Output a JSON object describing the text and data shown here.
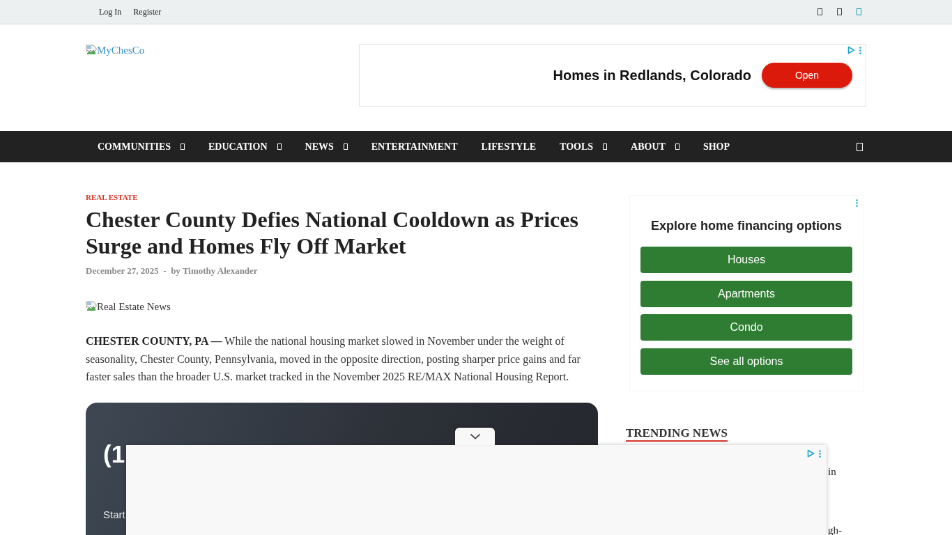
{
  "top_bar": {
    "links": [
      "Log In",
      "Register"
    ],
    "social_icons": [
      {
        "color": "#444444"
      },
      {
        "color": "#444444"
      },
      {
        "color": "#1e9bb3"
      }
    ]
  },
  "header": {
    "logo_alt": "MyChesCo",
    "ad": {
      "headline": "Homes in Redlands, Colorado",
      "button": "Open"
    }
  },
  "nav": {
    "items": [
      {
        "label": "COMMUNITIES",
        "has_submenu": true
      },
      {
        "label": "EDUCATION",
        "has_submenu": true
      },
      {
        "label": "NEWS",
        "has_submenu": true
      },
      {
        "label": "ENTERTAINMENT",
        "has_submenu": false
      },
      {
        "label": "LIFESTYLE",
        "has_submenu": false
      },
      {
        "label": "TOOLS",
        "has_submenu": true
      },
      {
        "label": "ABOUT",
        "has_submenu": true
      },
      {
        "label": "SHOP",
        "has_submenu": false
      }
    ]
  },
  "article": {
    "category": "REAL ESTATE",
    "title": "Chester County Defies National Cooldown as Prices Surge and Homes Fly Off Market",
    "meta": "December 27, 2025  -  by Timothy Alexander",
    "image_alt": "Real Estate News",
    "lead": "**CHESTER COUNTY, PA —** While the national housing market slowed in November under the weight of seasonality, Chester County, Pennsylvania, moved in the opposite direction, posting sharper price gains and far faster sales than the broader U.S. market tracked in the November 2025 RE/MAX National Housing Report.",
    "card": {
      "heading": "(1",
      "text": "Start"
    }
  },
  "sidebar": {
    "ad": {
      "title": "Explore home financing options",
      "buttons": [
        "Houses",
        "Apartments",
        "Condo",
        "See all options"
      ]
    },
    "trending": {
      "title": "TRENDING NEWS",
      "items": [
        "in",
        "gh-"
      ]
    }
  }
}
